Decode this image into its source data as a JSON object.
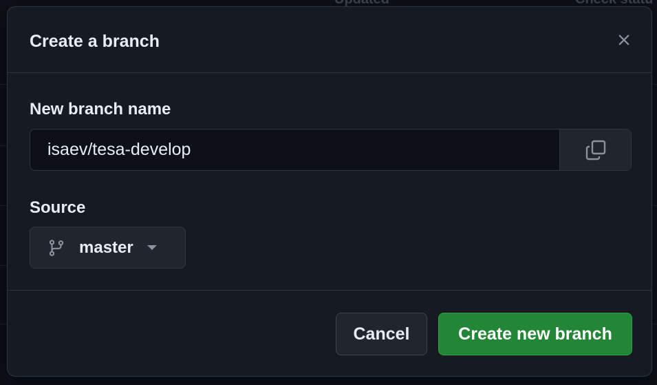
{
  "background": {
    "col_updated": "Updated",
    "col_check_status": "Check statu"
  },
  "dialog": {
    "title": "Create a branch",
    "close_icon": "close-icon"
  },
  "branch_name": {
    "label": "New branch name",
    "value": "isaev/tesa-develop",
    "copy_icon": "copy-icon"
  },
  "source": {
    "label": "Source",
    "branch_icon": "git-branch-icon",
    "value": "master",
    "caret_icon": "caret-down-icon"
  },
  "footer": {
    "cancel_label": "Cancel",
    "create_label": "Create new branch"
  },
  "colors": {
    "background": "#0d1117",
    "dialog_bg": "#161b22",
    "border": "#30363d",
    "primary_button": "#238636",
    "text": "#e6edf3",
    "muted": "#8b949e"
  }
}
